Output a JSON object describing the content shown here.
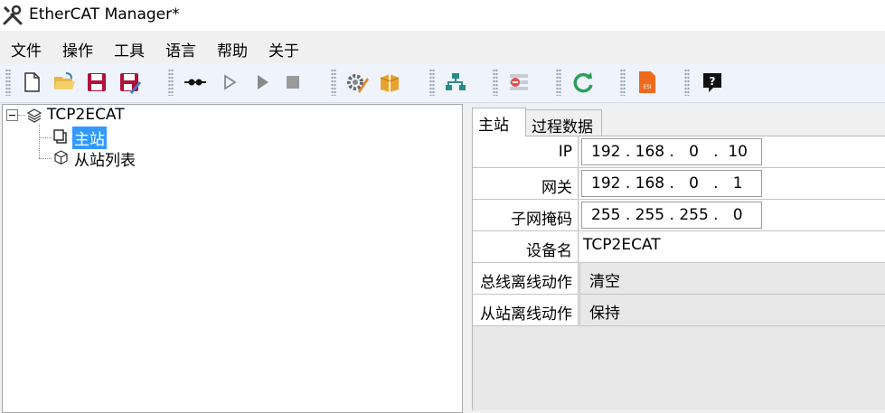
{
  "window": {
    "title": "EtherCAT Manager*"
  },
  "menu": [
    "文件",
    "操作",
    "工具",
    "语言",
    "帮助",
    "关于"
  ],
  "toolbar": {
    "buttons": [
      "new-file-icon",
      "open-folder-icon",
      "save-icon",
      "save-as-icon",
      "connect-icon",
      "play-outline-icon",
      "play-icon",
      "stop-icon",
      "settings-icon",
      "package-icon",
      "network-tree-icon",
      "remove-list-icon",
      "refresh-icon",
      "esi-file-icon",
      "help-icon"
    ],
    "esi_text": "ESI",
    "help_text": "?"
  },
  "tree": {
    "root": "TCP2ECAT",
    "children": [
      "主站",
      "从站列表"
    ],
    "selected": "主站"
  },
  "tabs": [
    "主站",
    "过程数据"
  ],
  "active_tab": "主站",
  "properties": [
    {
      "label": "IP",
      "type": "ip",
      "value": "192 . 168 .   0   .  10"
    },
    {
      "label": "网关",
      "type": "ip",
      "value": "192 . 168 .   0   .   1"
    },
    {
      "label": "子网掩码",
      "type": "ip",
      "value": "255 . 255 . 255 .   0"
    },
    {
      "label": "设备名",
      "type": "text",
      "value": "TCP2ECAT"
    },
    {
      "label": "总线离线动作",
      "type": "combo",
      "value": "清空"
    },
    {
      "label": "从站离线动作",
      "type": "combo",
      "value": "保持"
    }
  ],
  "colors": {
    "selection": "#3399ff",
    "toolbar_bg": "#eef3fc",
    "accent_green": "#2e9e5b",
    "save_red": "#b0103a",
    "esi_orange": "#f06a1d"
  }
}
